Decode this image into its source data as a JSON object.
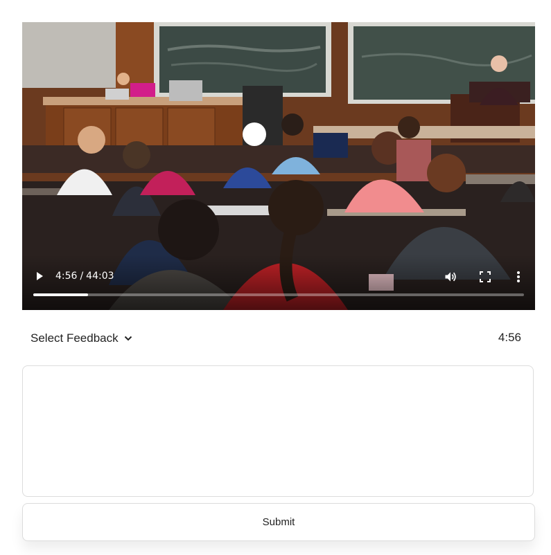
{
  "video": {
    "current_time": "4:56",
    "separator": "/",
    "duration": "44:03",
    "progress_fraction": 0.112,
    "icons": [
      "play-icon",
      "volume-icon",
      "fullscreen-icon",
      "more-vert-icon"
    ]
  },
  "feedback": {
    "select_label": "Select Feedback",
    "timestamp": "4:56"
  },
  "comment": {
    "value": ""
  },
  "actions": {
    "submit_label": "Submit"
  }
}
